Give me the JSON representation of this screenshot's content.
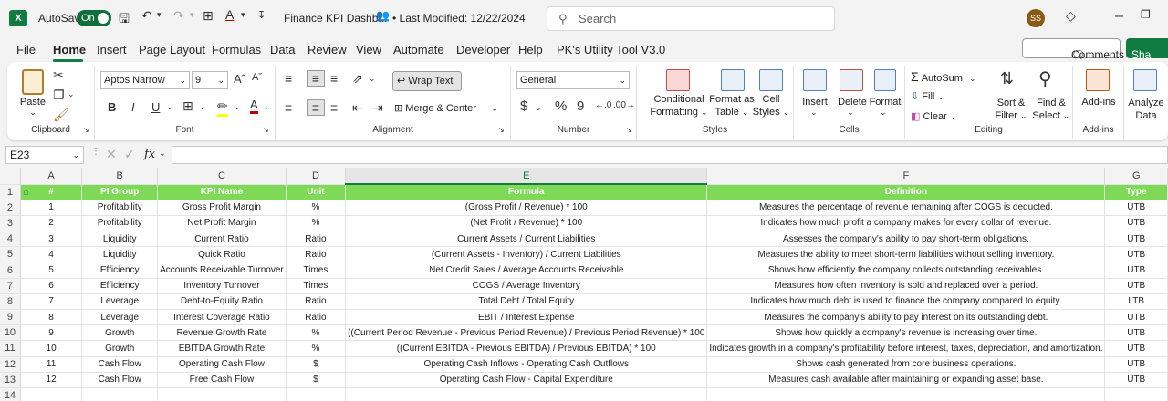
{
  "titlebar": {
    "app_letter": "X",
    "autosave_label": "AutoSave",
    "autosave_state": "On",
    "doc_title": "Finance KPI Dashb...",
    "modified": "• Last Modified: 12/22/2024",
    "search_placeholder": "Search",
    "user_initials": "SS"
  },
  "menu": {
    "items": [
      "File",
      "Home",
      "Insert",
      "Page Layout",
      "Formulas",
      "Data",
      "Review",
      "View",
      "Automate",
      "Developer",
      "Help",
      "PK's Utility Tool V3.0"
    ],
    "comments": "Comments",
    "share": "Sha"
  },
  "ribbon": {
    "clipboard": {
      "paste": "Paste",
      "label": "Clipboard"
    },
    "font": {
      "name": "Aptos Narrow",
      "size": "9",
      "label": "Font",
      "bold": "B",
      "italic": "I",
      "underline": "U"
    },
    "alignment": {
      "wrap": "Wrap Text",
      "merge": "Merge & Center",
      "label": "Alignment"
    },
    "number": {
      "format": "General",
      "label": "Number",
      "currency": "$",
      "percent": "%",
      "comma": "9"
    },
    "styles": {
      "cond": [
        "Conditional",
        "Formatting"
      ],
      "table": [
        "Format as",
        "Table"
      ],
      "cell": [
        "Cell",
        "Styles"
      ],
      "label": "Styles"
    },
    "cells": {
      "insert": "Insert",
      "delete": "Delete",
      "format": "Format",
      "label": "Cells"
    },
    "editing": {
      "autosum": "AutoSum",
      "fill": "Fill",
      "clear": "Clear",
      "sort": [
        "Sort &",
        "Filter"
      ],
      "find": [
        "Find &",
        "Select"
      ],
      "label": "Editing"
    },
    "addins": {
      "addins": "Add-ins",
      "label": "Add-ins"
    },
    "analyze": {
      "text": [
        "Analyze",
        "Data"
      ]
    }
  },
  "formula_bar": {
    "cell_ref": "E23",
    "fx": "fx"
  },
  "sheet": {
    "columns": [
      "A",
      "B",
      "C",
      "D",
      "E",
      "F",
      "G"
    ],
    "header": {
      "row": "1",
      "cols": [
        "#",
        "PI Group",
        "KPI Name",
        "Unit",
        "Formula",
        "Definition",
        "Type"
      ]
    },
    "rows": [
      {
        "r": "2",
        "c": [
          "1",
          "Profitability",
          "Gross Profit Margin",
          "%",
          "(Gross Profit / Revenue) * 100",
          "Measures the percentage of revenue remaining after COGS is deducted.",
          "UTB"
        ]
      },
      {
        "r": "3",
        "c": [
          "2",
          "Profitability",
          "Net Profit Margin",
          "%",
          "(Net Profit / Revenue) * 100",
          "Indicates how much profit a company makes for every dollar of revenue.",
          "UTB"
        ]
      },
      {
        "r": "4",
        "c": [
          "3",
          "Liquidity",
          "Current Ratio",
          "Ratio",
          "Current Assets / Current Liabilities",
          "Assesses the company's ability to pay short-term obligations.",
          "UTB"
        ]
      },
      {
        "r": "5",
        "c": [
          "4",
          "Liquidity",
          "Quick Ratio",
          "Ratio",
          "(Current Assets - Inventory) / Current Liabilities",
          "Measures the ability to meet short-term liabilities without selling inventory.",
          "UTB"
        ]
      },
      {
        "r": "6",
        "c": [
          "5",
          "Efficiency",
          "Accounts Receivable Turnover",
          "Times",
          "Net Credit Sales / Average Accounts Receivable",
          "Shows how efficiently the company collects outstanding receivables.",
          "UTB"
        ]
      },
      {
        "r": "7",
        "c": [
          "6",
          "Efficiency",
          "Inventory Turnover",
          "Times",
          "COGS / Average Inventory",
          "Measures how often inventory is sold and replaced over a period.",
          "UTB"
        ]
      },
      {
        "r": "8",
        "c": [
          "7",
          "Leverage",
          "Debt-to-Equity Ratio",
          "Ratio",
          "Total Debt / Total Equity",
          "Indicates how much debt is used to finance the company compared to equity.",
          "LTB"
        ]
      },
      {
        "r": "9",
        "c": [
          "8",
          "Leverage",
          "Interest Coverage Ratio",
          "Ratio",
          "EBIT / Interest Expense",
          "Measures the company's ability to pay interest on its outstanding debt.",
          "UTB"
        ]
      },
      {
        "r": "10",
        "c": [
          "9",
          "Growth",
          "Revenue Growth Rate",
          "%",
          "((Current Period Revenue - Previous Period Revenue) / Previous Period Revenue) * 100",
          "Shows how quickly a company's revenue is increasing over time.",
          "UTB"
        ]
      },
      {
        "r": "11",
        "c": [
          "10",
          "Growth",
          "EBITDA Growth Rate",
          "%",
          "((Current EBITDA - Previous EBITDA) / Previous EBITDA) * 100",
          "Indicates growth in a company's profitability before interest, taxes, depreciation, and amortization.",
          "UTB"
        ]
      },
      {
        "r": "12",
        "c": [
          "11",
          "Cash Flow",
          "Operating Cash Flow",
          "$",
          "Operating Cash Inflows - Operating Cash Outflows",
          "Shows cash generated from core business operations.",
          "UTB"
        ]
      },
      {
        "r": "13",
        "c": [
          "12",
          "Cash Flow",
          "Free Cash Flow",
          "$",
          "Operating Cash Flow - Capital Expenditure",
          "Measures cash available after maintaining or expanding asset base.",
          "UTB"
        ]
      },
      {
        "r": "14",
        "c": [
          "",
          "",
          "",
          "",
          "",
          "",
          ""
        ]
      }
    ]
  }
}
